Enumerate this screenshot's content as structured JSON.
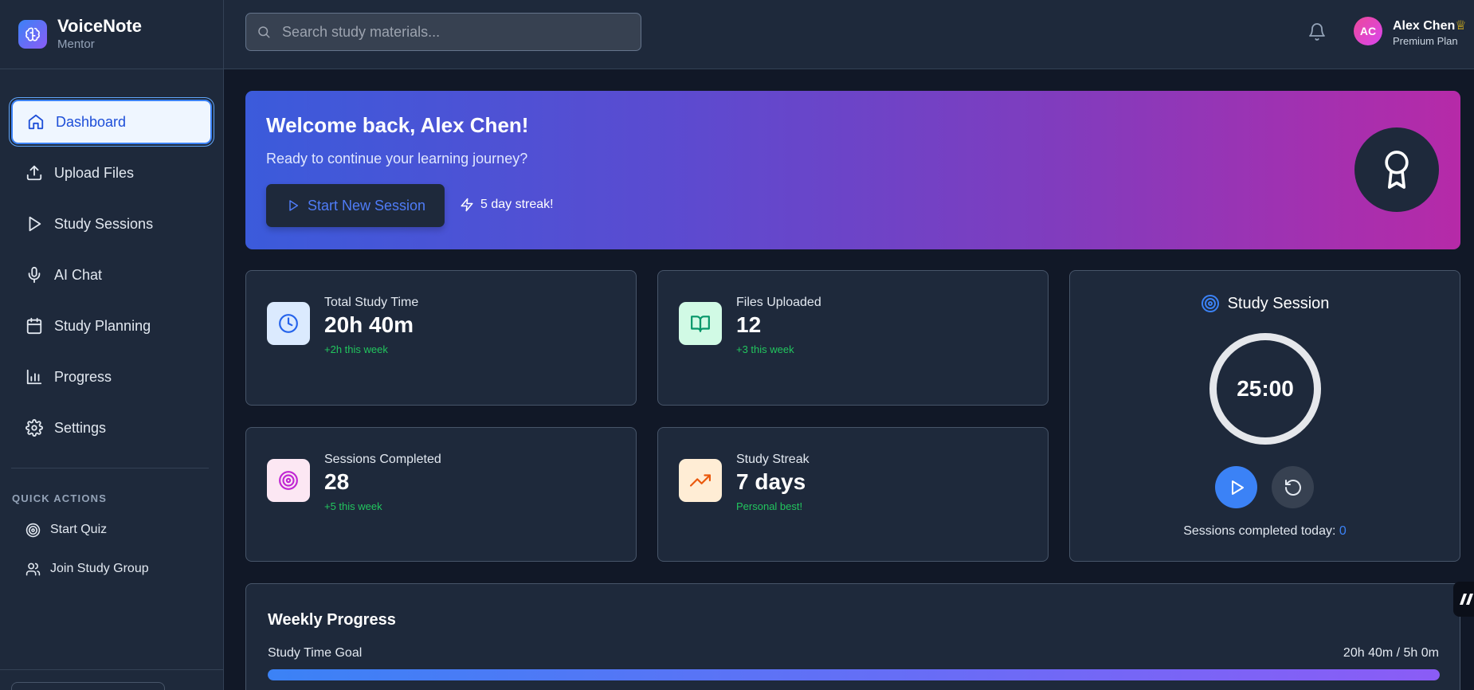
{
  "brand": {
    "name": "VoiceNote",
    "subtitle": "Mentor"
  },
  "sidebar": {
    "items": [
      {
        "label": "Dashboard",
        "icon": "home-icon",
        "active": true
      },
      {
        "label": "Upload Files",
        "icon": "upload-icon"
      },
      {
        "label": "Study Sessions",
        "icon": "play-icon"
      },
      {
        "label": "AI Chat",
        "icon": "microphone-icon"
      },
      {
        "label": "Study Planning",
        "icon": "calendar-icon"
      },
      {
        "label": "Progress",
        "icon": "bar-chart-icon"
      },
      {
        "label": "Settings",
        "icon": "gear-icon"
      }
    ],
    "quick_actions_title": "QUICK ACTIONS",
    "quick_actions": [
      {
        "label": "Start Quiz",
        "icon": "target-icon"
      },
      {
        "label": "Join Study Group",
        "icon": "users-icon"
      }
    ]
  },
  "topbar": {
    "search_placeholder": "Search study materials...",
    "avatar_initials": "AC",
    "user_name": "Alex Chen",
    "user_badge": "♕",
    "user_plan": "Premium Plan"
  },
  "welcome": {
    "title": "Welcome back, Alex Chen!",
    "subtitle": "Ready to continue your learning journey?",
    "button_label": "Start New Session",
    "streak_text": "5 day streak!"
  },
  "stats": [
    {
      "label": "Total Study Time",
      "value": "20h 40m",
      "delta": "+2h this week",
      "icon": "clock-icon",
      "icon_bg": "#dbeafe",
      "icon_color": "#2563eb"
    },
    {
      "label": "Files Uploaded",
      "value": "12",
      "delta": "+3 this week",
      "icon": "book-icon",
      "icon_bg": "#d1fae5",
      "icon_color": "#059669"
    },
    {
      "label": "Sessions Completed",
      "value": "28",
      "delta": "+5 this week",
      "icon": "target-icon",
      "icon_bg": "#fce7f3",
      "icon_color": "#c026d3"
    },
    {
      "label": "Study Streak",
      "value": "7 days",
      "delta": "Personal best!",
      "icon": "trending-up-icon",
      "icon_bg": "#ffedd5",
      "icon_color": "#ea580c"
    }
  ],
  "session": {
    "title": "Study Session",
    "timer": "25:00",
    "completed_label": "Sessions completed today:",
    "completed_count": "0"
  },
  "weekly": {
    "title": "Weekly Progress",
    "goal_label": "Study Time Goal",
    "goal_value": "20h 40m / 5h 0m",
    "goal_progress_percent": 100
  },
  "colors": {
    "accent": "#3b82f6",
    "background": "#111827",
    "panel": "#1e293b",
    "success": "#22c55e"
  }
}
